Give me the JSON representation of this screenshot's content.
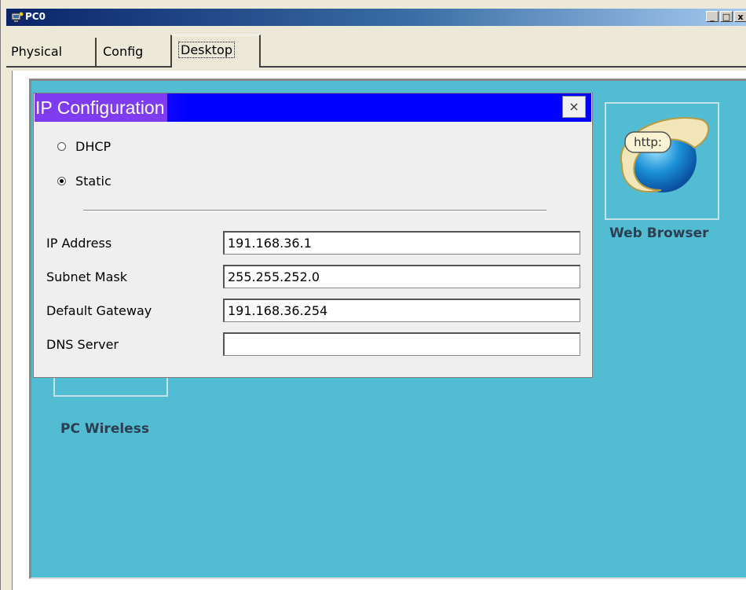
{
  "window": {
    "title": "PC0",
    "controls": [
      "_",
      "□",
      "x"
    ]
  },
  "tabs": [
    {
      "label": "Physical"
    },
    {
      "label": "Config"
    },
    {
      "label": "Desktop"
    }
  ],
  "desktop": {
    "apps": [
      {
        "label": "Web Browser",
        "icon": "http-browser-icon",
        "icon_text": "http:"
      },
      {
        "label": "PC Wireless",
        "icon": "wireless-icon"
      }
    ]
  },
  "ip_config": {
    "title": "IP Configuration",
    "close_label": "×",
    "mode_dhcp": "DHCP",
    "mode_static": "Static",
    "selected_mode": "Static",
    "fields": {
      "ip_label": "IP Address",
      "ip_value": "191.168.36.1",
      "mask_label": "Subnet Mask",
      "mask_value": "255.255.252.0",
      "gateway_label": "Default Gateway",
      "gateway_value": "191.168.36.254",
      "dns_label": "DNS Server",
      "dns_value": ""
    }
  },
  "colors": {
    "desktop_bg": "#52bcd3",
    "dialog_title_bg": "#0000ff",
    "dialog_title_highlight": "#7f3bf0",
    "titlebar_start": "#0a246a"
  }
}
